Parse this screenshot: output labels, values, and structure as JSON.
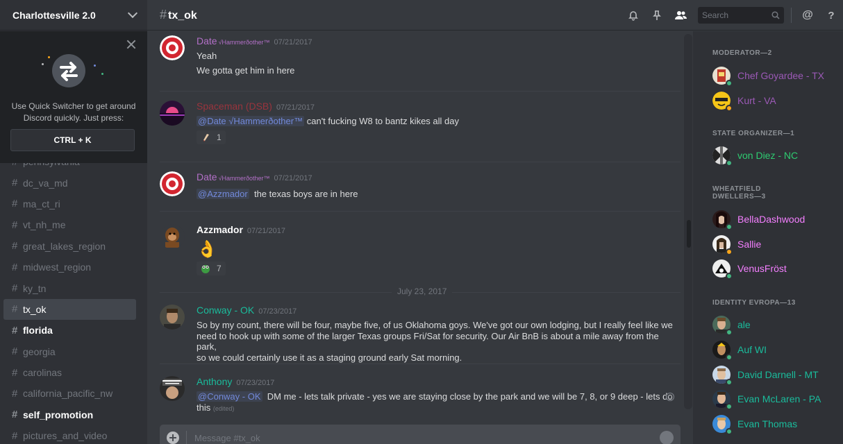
{
  "guild": {
    "name": "Charlottesville 2.0"
  },
  "quick_switcher": {
    "text_line1": "Use Quick Switcher to get around",
    "text_line2": "Discord quickly. Just press:",
    "shortcut": "CTRL + K"
  },
  "channels": [
    {
      "name": "pennsylvania",
      "state": "normal"
    },
    {
      "name": "dc_va_md",
      "state": "normal"
    },
    {
      "name": "ma_ct_ri",
      "state": "normal"
    },
    {
      "name": "vt_nh_me",
      "state": "normal"
    },
    {
      "name": "great_lakes_region",
      "state": "normal"
    },
    {
      "name": "midwest_region",
      "state": "normal"
    },
    {
      "name": "ky_tn",
      "state": "normal"
    },
    {
      "name": "tx_ok",
      "state": "active"
    },
    {
      "name": "florida",
      "state": "unread"
    },
    {
      "name": "georgia",
      "state": "normal"
    },
    {
      "name": "carolinas",
      "state": "normal"
    },
    {
      "name": "california_pacific_nw",
      "state": "normal"
    },
    {
      "name": "self_promotion",
      "state": "unread"
    },
    {
      "name": "pictures_and_video",
      "state": "normal"
    }
  ],
  "header": {
    "hash": "#",
    "channel": "tx_ok",
    "search_placeholder": "Search"
  },
  "messages": [
    {
      "author": "Date",
      "tag": "√Hammerðother™",
      "timestamp": "07/21/2017",
      "lines": [
        "Yeah",
        "We gotta get him in here"
      ]
    },
    {
      "author": "Spaceman (DSB)",
      "timestamp": "07/21/2017",
      "mention": "@Date √Hammerðother™",
      "text": "can't fucking W8 to bantz kikes all day",
      "reaction_count": "1"
    },
    {
      "author": "Date",
      "tag": "√Hammerðother™",
      "timestamp": "07/21/2017",
      "mention": "@Azzmador",
      "text": "the texas boys are in here"
    },
    {
      "author": "Azzmador",
      "timestamp": "07/21/2017",
      "emoji": "👌",
      "reaction_count": "7"
    },
    {
      "author": "Conway - OK",
      "timestamp": "07/23/2017",
      "lines": [
        "So by my count, there will be four, maybe five, of us Oklahoma goys. We've got our own lodging, but I really feel like we",
        "need to hook up with some of the larger Texas groups Fri/Sat for security. Our Air BnB is about a mile away from the park,",
        "so we could certainly use it as a staging ground early Sat morning."
      ]
    },
    {
      "author": "Anthony",
      "timestamp": "07/23/2017",
      "mention": "@Conway - OK",
      "text": "DM me - lets talk private - yes we are staying close by the park and we will be 7, 8, or 9 deep - lets do",
      "text2": "this",
      "edited": "(edited)"
    }
  ],
  "date_divider": "July 23, 2017",
  "composer": {
    "placeholder": "Message #tx_ok"
  },
  "member_groups": [
    {
      "title": "MODERATOR—2",
      "members": [
        {
          "name": "Chef Goyardee - TX",
          "color": "#9b59b6",
          "status": "online"
        },
        {
          "name": "Kurt - VA",
          "color": "#9b59b6",
          "status": "idle"
        }
      ]
    },
    {
      "title": "STATE ORGANIZER—1",
      "members": [
        {
          "name": "von Diez - NC",
          "color": "#2ecc71",
          "status": "online"
        }
      ]
    },
    {
      "title": "WHEATFIELD DWELLERS—3",
      "members": [
        {
          "name": "BellaDashwood",
          "color": "#f47fff",
          "status": "online"
        },
        {
          "name": "Sallie",
          "color": "#f47fff",
          "status": "idle"
        },
        {
          "name": "VenusFröst",
          "color": "#f47fff",
          "status": "online"
        }
      ]
    },
    {
      "title": "IDENTITY EVROPA—13",
      "members": [
        {
          "name": "ale",
          "color": "#1abc9c",
          "status": "online"
        },
        {
          "name": "Auf WI",
          "color": "#1abc9c",
          "status": "online"
        },
        {
          "name": "David Darnell - MT",
          "color": "#1abc9c",
          "status": "online"
        },
        {
          "name": "Evan McLaren - PA",
          "color": "#1abc9c",
          "status": "online"
        },
        {
          "name": "Evan Thomas",
          "color": "#1abc9c",
          "status": "online"
        }
      ]
    }
  ],
  "colors": {
    "online": "#43b581",
    "idle": "#faa61a",
    "date_user": "#b370c8",
    "spaceman_user": "#99343d",
    "conway_user": "#1abc9c",
    "anthony_user": "#1abc9c"
  }
}
